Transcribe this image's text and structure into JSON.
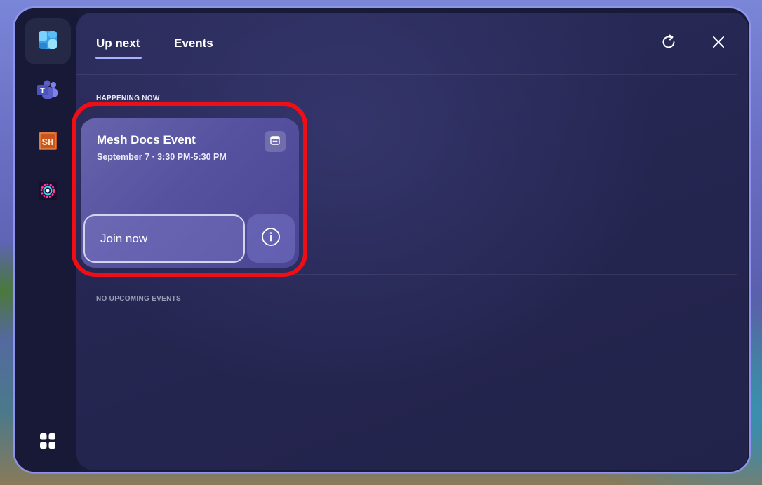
{
  "tabs": [
    {
      "label": "Up next",
      "active": true
    },
    {
      "label": "Events",
      "active": false
    }
  ],
  "sections": {
    "happening_now": "HAPPENING NOW",
    "upcoming": "NO UPCOMING EVENTS"
  },
  "event": {
    "title": "Mesh Docs Event",
    "datetime": "September 7 · 3:30 PM-5:30 PM",
    "join_label": "Join now"
  },
  "rail": {
    "items": [
      {
        "name": "events-app",
        "icon": "widget-board-icon",
        "active": true
      },
      {
        "name": "teams",
        "icon": "teams-icon",
        "label": "T"
      },
      {
        "name": "sh-app",
        "icon": "sh-app-icon",
        "label": "SH"
      },
      {
        "name": "circle-app",
        "icon": "target-app-icon"
      },
      {
        "name": "all-apps",
        "icon": "apps-grid-icon"
      }
    ]
  },
  "colors": {
    "accent": "#a9b2ff",
    "highlight": "#ee0f16",
    "card": "#5b58a4",
    "panel": "#25264f"
  }
}
